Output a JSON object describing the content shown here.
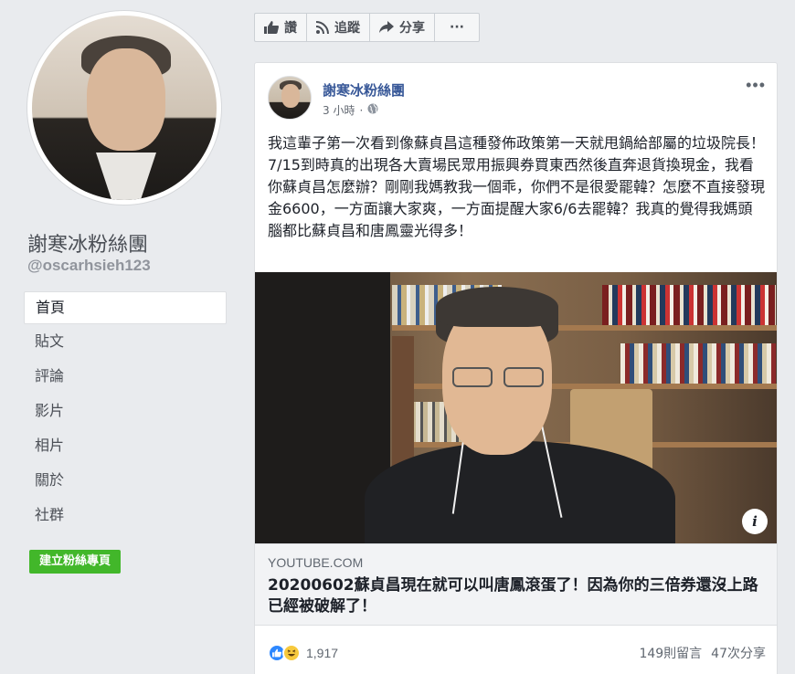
{
  "sidebar": {
    "page_name": "謝寒冰粉絲團",
    "handle": "@oscarhsieh123",
    "nav": [
      {
        "label": "首頁"
      },
      {
        "label": "貼文"
      },
      {
        "label": "評論"
      },
      {
        "label": "影片"
      },
      {
        "label": "相片"
      },
      {
        "label": "關於"
      },
      {
        "label": "社群"
      }
    ],
    "create_page_label": "建立粉絲專頁"
  },
  "actions": {
    "like_label": "讚",
    "follow_label": "追蹤",
    "share_label": "分享",
    "more_label": "···"
  },
  "post": {
    "author": "謝寒冰粉絲團",
    "time": "3 小時",
    "separator": "·",
    "menu": "•••",
    "text": "我這輩子第一次看到像蘇貞昌這種發佈政策第一天就甩鍋給部屬的垃圾院長！7/15到時真的出現各大賣場民眾用振興券買東西然後直奔退貨換現金，我看你蘇貞昌怎麼辦？剛剛我媽教我一個乖，你們不是很愛罷韓？怎麼不直接發現金6600，一方面讓大家爽，一方面提醒大家6/6去罷韓？我真的覺得我媽頭腦都比蘇貞昌和唐鳳靈光得多！",
    "link": {
      "domain": "YOUTUBE.COM",
      "title": "20200602蘇貞昌現在就可以叫唐鳳滾蛋了！因為你的三倍券還沒上路已經被破解了！",
      "info_icon": "i"
    },
    "reactions": {
      "count": "1,917",
      "comments": "149則留言",
      "shares": "47次分享"
    }
  },
  "colors": {
    "background": "#e9ebee",
    "link_blue": "#385898",
    "green_button": "#42b72a",
    "like_blue": "#2d88ff"
  }
}
